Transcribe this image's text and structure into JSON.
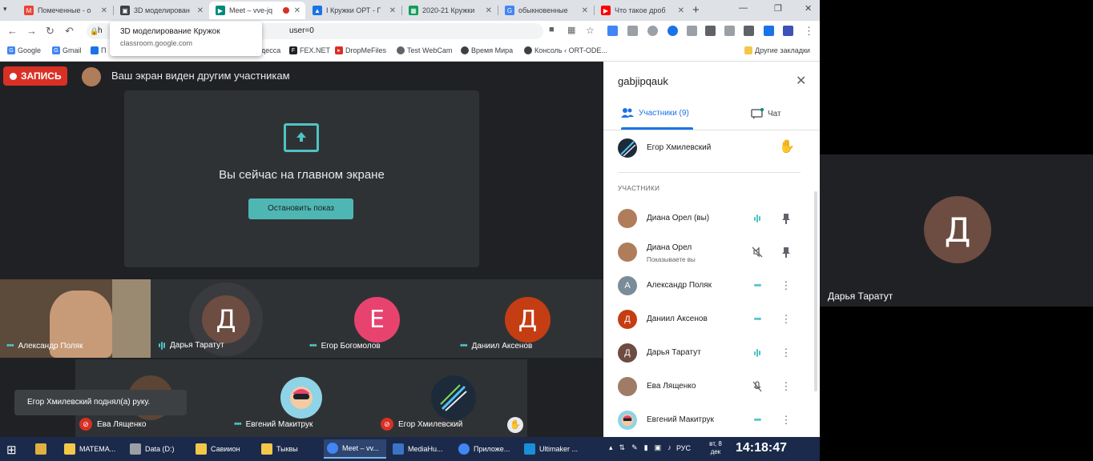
{
  "browser": {
    "tabs": [
      {
        "label": "Помеченные - о",
        "icon": "gmail-icon",
        "color": "#ea4335"
      },
      {
        "label": "3D моделирован",
        "icon": "classroom-icon",
        "color": "#3c4043"
      },
      {
        "label": "Meet – vve-jq",
        "icon": "meet-icon",
        "color": "#00897b"
      },
      {
        "label": "I Кружки ОРТ - Г",
        "icon": "drive-icon",
        "color": "#1a73e8"
      },
      {
        "label": "2020-21 Кружки",
        "icon": "sheets-icon",
        "color": "#0f9d58"
      },
      {
        "label": "обыкновенные",
        "icon": "google-icon",
        "color": "#4285f4"
      },
      {
        "label": "Что такое дроб",
        "icon": "youtube-icon",
        "color": "#ff0000"
      }
    ],
    "tab_add": "+",
    "url": "h                                                                                    user=0",
    "tooltip": {
      "title": "3D моделирование Кружок",
      "url": "classroom.google.com"
    },
    "bookmarks": [
      "Google",
      "Gmail",
      "П",
      "десса",
      "FEX.NET",
      "DropMeFiles",
      "Test WebCam",
      "Время Мира",
      "Консоль ‹ ORT-ODE...",
      "Другие закладки"
    ]
  },
  "meet": {
    "record_label": "ЗАПИСЬ",
    "screen_shared_message": "Ваш экран виден другим участникам",
    "presenting_text": "Вы сейчас на главном экране",
    "stop_presenting_label": "Остановить показ",
    "tiles": [
      {
        "name": "Александр Поляк",
        "status": "speaking-dots",
        "avatar_letter": ""
      },
      {
        "name": "Дарья Таратут",
        "status": "audio-bars",
        "avatar_letter": "Д",
        "color": "#6d4c41"
      },
      {
        "name": "Егор Богомолов",
        "status": "speaking-dots",
        "avatar_letter": "Е",
        "color": "#e8436f"
      },
      {
        "name": "Даниил Аксенов",
        "status": "speaking-dots",
        "avatar_letter": "Д",
        "color": "#c53d13"
      },
      {
        "name": "Ева Лященко",
        "status": "muted",
        "avatar_letter": ""
      },
      {
        "name": "Евгений Макитрук",
        "status": "speaking-dots",
        "avatar_letter": ""
      },
      {
        "name": "Егор Хмилевский",
        "status": "muted",
        "avatar_letter": ""
      }
    ],
    "toast": "Егор Хмилевский поднял(а) руку."
  },
  "panel": {
    "title": "gabjipqauk",
    "tab_people": "Участники (9)",
    "tab_chat": "Чат",
    "raised_hand_name": "Егор Хмилевский",
    "section_label": "УЧАСТНИКИ",
    "participants": [
      {
        "name": "Диана Орел (вы)",
        "sub": "",
        "letter": "",
        "color": "#b07d5a",
        "status": "audio-bars",
        "action": "pin"
      },
      {
        "name": "Диана Орел",
        "sub": "Показываете вы",
        "letter": "",
        "color": "#b07d5a",
        "status": "audio-off",
        "action": "pin"
      },
      {
        "name": "Александр Поляк",
        "sub": "",
        "letter": "А",
        "color": "#7a8c99",
        "status": "speaking-dots",
        "action": "more"
      },
      {
        "name": "Даниил Аксенов",
        "sub": "",
        "letter": "Д",
        "color": "#c53d13",
        "status": "speaking-dots",
        "action": "more"
      },
      {
        "name": "Дарья Таратут",
        "sub": "",
        "letter": "Д",
        "color": "#6d4c41",
        "status": "audio-bars",
        "action": "more"
      },
      {
        "name": "Ева Лященко",
        "sub": "",
        "letter": "",
        "color": "#a07c66",
        "status": "mic-off",
        "action": "more"
      },
      {
        "name": "Евгений Макитрук",
        "sub": "",
        "letter": "",
        "color": "#8fd3e6",
        "status": "speaking-dots",
        "action": "more"
      }
    ]
  },
  "right_pane": {
    "avatar_letter": "Д",
    "name": "Дарья Таратут"
  },
  "taskbar": {
    "items": [
      {
        "label": "",
        "color": "#e0b040"
      },
      {
        "label": "МАТЕМА...",
        "color": "#f3c74a"
      },
      {
        "label": "Data (D:)",
        "color": "#9aa0a6"
      },
      {
        "label": "Савиион",
        "color": "#f3c74a"
      },
      {
        "label": "Тыквы",
        "color": "#f3c74a"
      },
      {
        "label": "Meet – vv...",
        "color": "#4285f4"
      },
      {
        "label": "MediaHu...",
        "color": "#3b73c6"
      },
      {
        "label": "Приложе...",
        "color": "#4285f4"
      },
      {
        "label": "Ultimaker ...",
        "color": "#1a8fd8"
      }
    ],
    "lang": "РУС",
    "date_line1": "вт, 8",
    "date_line2": "дек",
    "time": "14:18:47"
  }
}
